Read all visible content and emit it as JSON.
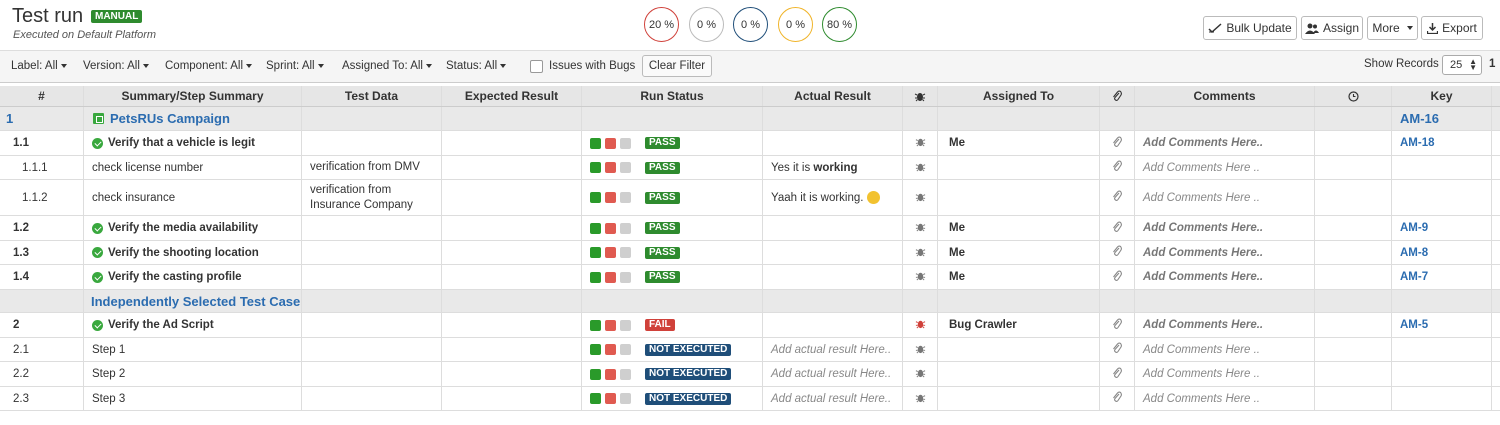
{
  "header": {
    "title": "Test run",
    "badge": "MANUAL",
    "subtitle": "Executed on Default Platform",
    "progress": [
      {
        "label": "20 %",
        "color": "#d0413a"
      },
      {
        "label": "0 %",
        "color": "#bbbbbb"
      },
      {
        "label": "0 %",
        "color": "#1f4e79"
      },
      {
        "label": "0 %",
        "color": "#f0b429"
      },
      {
        "label": "80 %",
        "color": "#2e8b2e"
      }
    ],
    "buttons": {
      "bulk_update": "Bulk Update",
      "assign": "Assign",
      "more": "More",
      "export": "Export"
    }
  },
  "filters": {
    "label": "Label:",
    "label_value": "All",
    "version": "Version:",
    "version_value": "All",
    "component": "Component:",
    "component_value": "All",
    "sprint": "Sprint:",
    "sprint_value": "All",
    "assigned": "Assigned To:",
    "assigned_value": "All",
    "status": "Status:",
    "status_value": "All",
    "issues_with_bugs": "Issues with Bugs",
    "clear": "Clear Filter",
    "show_records": "Show Records",
    "records_value": "25",
    "page": "1"
  },
  "columns": [
    "#",
    "Summary/Step Summary",
    "Test Data",
    "Expected Result",
    "Run Status",
    "Actual Result",
    "",
    "Assigned To",
    "",
    "Comments",
    "",
    "Key"
  ],
  "rows": [
    {
      "num": "1",
      "summary": "PetsRUs Campaign",
      "key": "AM-16"
    },
    {
      "num": "1.1",
      "summary": "Verify that a vehicle is legit",
      "status": "PASS",
      "assigned": "Me",
      "comments": "Add Comments Here..",
      "key": "AM-18"
    },
    {
      "num": "1.1.1",
      "summary": "check license number",
      "test_data": "verification from DMV",
      "status": "PASS",
      "actual_pre": "Yes it is ",
      "actual_bold": "working",
      "comments": "Add Comments Here .."
    },
    {
      "num": "1.1.2",
      "summary": "check insurance",
      "test_data": "verification from Insurance Company",
      "status": "PASS",
      "actual_pre": "Yaah it is working.",
      "comments": "Add Comments Here .."
    },
    {
      "num": "1.2",
      "summary": "Verify the media availability",
      "status": "PASS",
      "assigned": "Me",
      "comments": "Add Comments Here..",
      "key": "AM-9"
    },
    {
      "num": "1.3",
      "summary": "Verify the shooting location",
      "status": "PASS",
      "assigned": "Me",
      "comments": "Add Comments Here..",
      "key": "AM-8"
    },
    {
      "num": "1.4",
      "summary": "Verify the casting profile",
      "status": "PASS",
      "assigned": "Me",
      "comments": "Add Comments Here..",
      "key": "AM-7"
    },
    {
      "summary": "Independently Selected Test Case"
    },
    {
      "num": "2",
      "summary": "Verify the Ad Script",
      "status": "FAIL",
      "assigned": "Bug Crawler",
      "comments": "Add Comments Here..",
      "key": "AM-5"
    },
    {
      "num": "2.1",
      "summary": "Step 1",
      "status": "NOT EXECUTED",
      "actual_placeholder": "Add actual result Here..",
      "comments": "Add Comments Here .."
    },
    {
      "num": "2.2",
      "summary": "Step 2",
      "status": "NOT EXECUTED",
      "actual_placeholder": "Add actual result Here..",
      "comments": "Add Comments Here .."
    },
    {
      "num": "2.3",
      "summary": "Step 3",
      "status": "NOT EXECUTED",
      "actual_placeholder": "Add actual result Here..",
      "comments": "Add Comments Here .."
    }
  ]
}
